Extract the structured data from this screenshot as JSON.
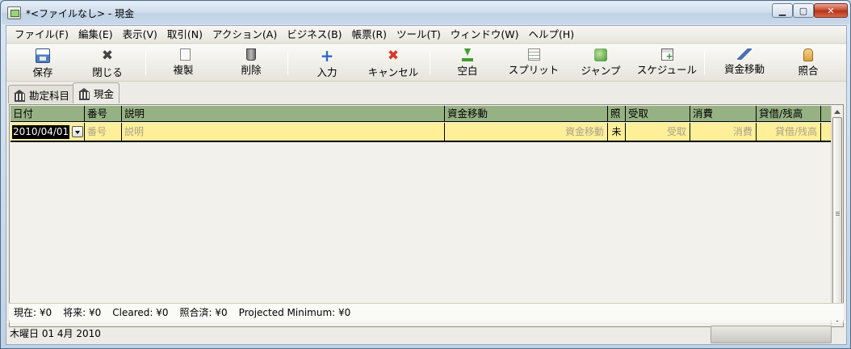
{
  "window": {
    "title": "*<ファイルなし> - 現金"
  },
  "menubar": {
    "items": [
      "ファイル(F)",
      "編集(E)",
      "表示(V)",
      "取引(N)",
      "アクション(A)",
      "ビジネス(B)",
      "帳票(R)",
      "ツール(T)",
      "ウィンドウ(W)",
      "ヘルプ(H)"
    ]
  },
  "toolbar": {
    "save": "保存",
    "close": "閉じる",
    "duplicate": "複製",
    "delete": "削除",
    "enter": "入力",
    "cancel": "キャンセル",
    "blank": "空白",
    "split": "スプリット",
    "jump": "ジャンプ",
    "schedule": "スケジュール",
    "transfer": "資金移動",
    "reconcile": "照合"
  },
  "tabs": [
    {
      "label": "勘定科目",
      "icon": "bank-icon",
      "active": false
    },
    {
      "label": "現金",
      "icon": "bank-icon",
      "active": true
    }
  ],
  "register": {
    "headers": [
      "日付",
      "番号",
      "説明",
      "資金移動",
      "照",
      "受取",
      "消費",
      "貸借/残高"
    ],
    "entry_row": {
      "date": "2010/04/01",
      "num": "番号",
      "description": "説明",
      "transfer": "資金移動",
      "reconcile": "未",
      "receive": "受取",
      "spend": "消費",
      "balance": "貸借/残高"
    }
  },
  "summary": {
    "present": "現在: ¥0",
    "future": "将来: ¥0",
    "cleared": "Cleared: ¥0",
    "reconciled": "照合済: ¥0",
    "projected_min": "Projected Minimum: ¥0"
  },
  "statusbar": {
    "text": "木曜日 01 4月 2010"
  },
  "colors": {
    "header_bg": "#96b183",
    "entry_row_bg": "#ffef98",
    "cancel_icon": "#d43a2a",
    "enter_icon": "#2f66c8"
  }
}
